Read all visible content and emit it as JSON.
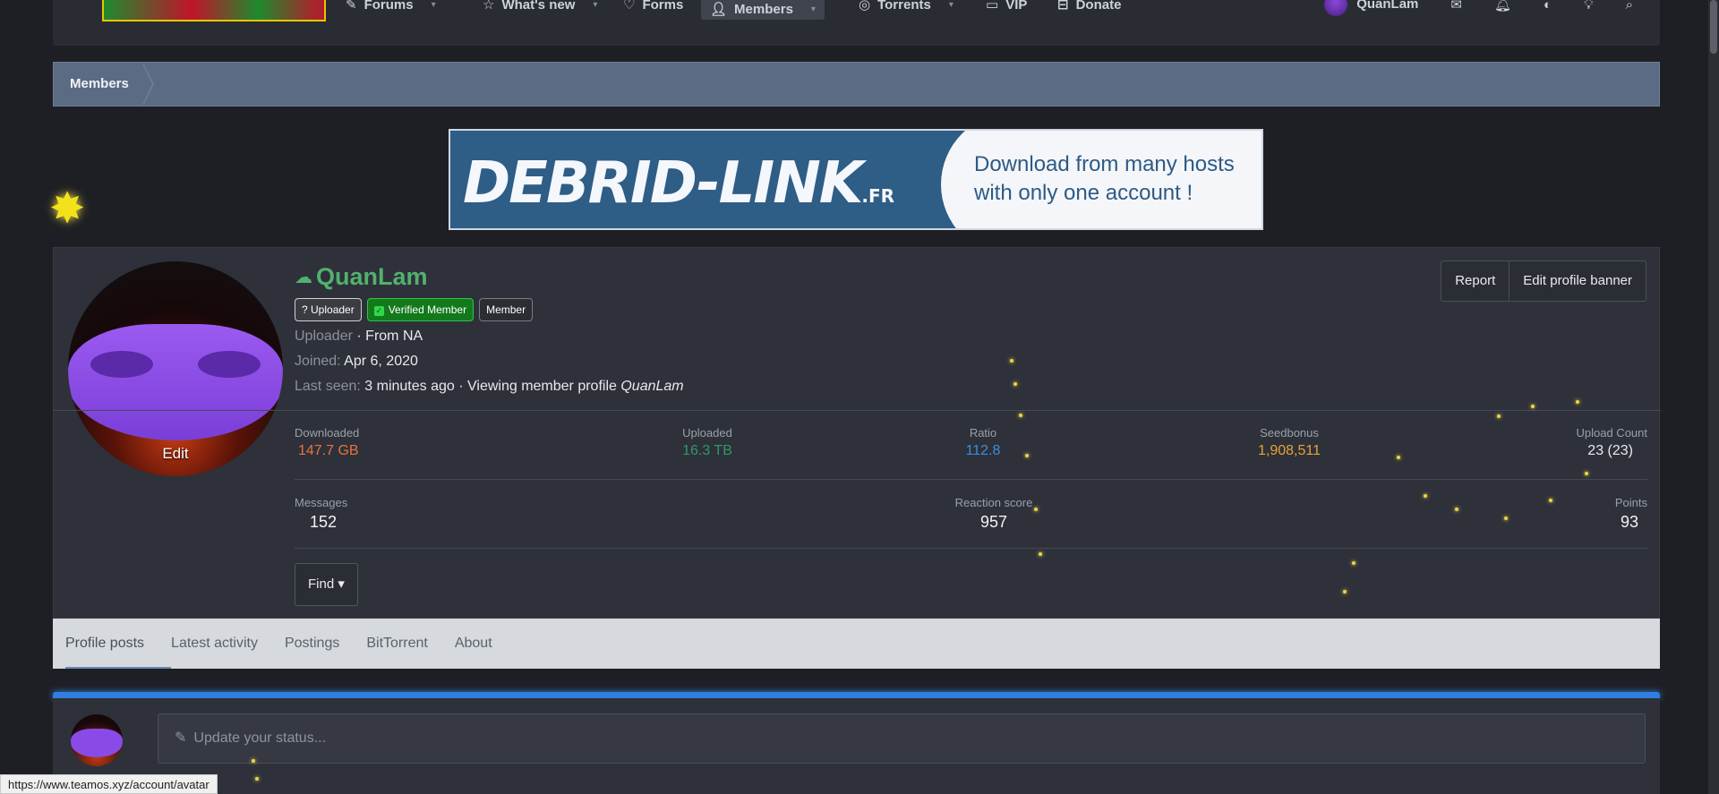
{
  "nav": {
    "items": [
      {
        "label": "Forums",
        "icon": "forums-icon",
        "has_caret": true
      },
      {
        "label": "What's new",
        "icon": "star-icon",
        "has_caret": true
      },
      {
        "label": "Forms",
        "icon": "heart-icon",
        "has_caret": false
      },
      {
        "label": "Members",
        "icon": "user-icon",
        "has_caret": true,
        "active": true
      },
      {
        "label": "Torrents",
        "icon": "torrent-icon",
        "has_caret": true
      },
      {
        "label": "VIP",
        "icon": "vip-icon",
        "has_caret": false
      },
      {
        "label": "Donate",
        "icon": "donate-icon",
        "has_caret": false
      }
    ],
    "user": "QuanLam"
  },
  "breadcrumb": {
    "label": "Members"
  },
  "banner": {
    "logo": "DEBRID-LINK",
    "tld": ".FR",
    "line1": "Download from many hosts",
    "line2": "with only one account !"
  },
  "profile": {
    "name": "QuanLam",
    "badges": {
      "uploader": "? Uploader",
      "verified": "Verified Member",
      "member": "Member"
    },
    "title": "Uploader",
    "from": "· From NA",
    "joined_label": "Joined:",
    "joined": "Apr 6, 2020",
    "last_seen_label": "Last seen:",
    "last_seen": "3 minutes ago · Viewing member profile",
    "last_seen_target": "QuanLam",
    "avatar_edit": "Edit",
    "buttons": {
      "report": "Report",
      "edit_banner": "Edit profile banner"
    },
    "stats": {
      "downloaded_label": "Downloaded",
      "downloaded": "147.7 GB",
      "uploaded_label": "Uploaded",
      "uploaded": "16.3 TB",
      "ratio_label": "Ratio",
      "ratio": "112.8",
      "seedbonus_label": "Seedbonus",
      "seedbonus": "1,908,511",
      "upload_count_label": "Upload Count",
      "upload_count": "23 (23)",
      "messages_label": "Messages",
      "messages": "152",
      "reaction_label": "Reaction score",
      "reaction": "957",
      "points_label": "Points",
      "points": "93"
    },
    "find": "Find ▾"
  },
  "tabs": [
    "Profile posts",
    "Latest activity",
    "Postings",
    "BitTorrent",
    "About"
  ],
  "status": {
    "placeholder": "Update your status..."
  },
  "statusbar": "https://www.teamos.xyz/account/avatar",
  "colors": {
    "accent": "#2f7ee0",
    "name": "#53b06e",
    "downloaded": "#e7743f",
    "uploaded": "#2e9a66",
    "ratio": "#3b8fe0",
    "seedbonus": "#e8a23a"
  }
}
